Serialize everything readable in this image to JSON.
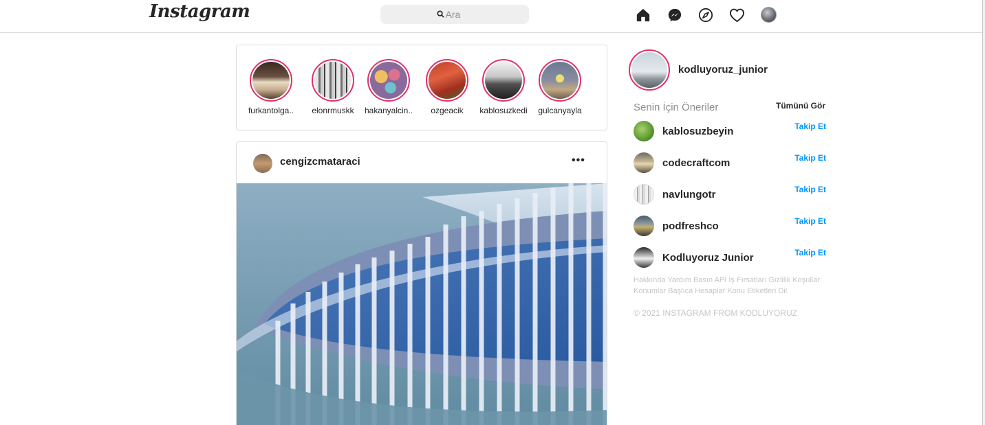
{
  "nav": {
    "logo": "Instagram",
    "search_placeholder": "Ara"
  },
  "stories": [
    {
      "name": "furkantolga.."
    },
    {
      "name": "elonrmuskk"
    },
    {
      "name": "hakanyalcin.."
    },
    {
      "name": "ozgeacik"
    },
    {
      "name": "kablosuzkedi"
    },
    {
      "name": "gulcanyayla"
    }
  ],
  "post": {
    "username": "cengizcmataraci",
    "more": "•••"
  },
  "sidebar": {
    "username": "kodluyoruz_junior",
    "suggestions_title": "Senin İçin Öneriler",
    "see_all": "Tümünü Gör",
    "suggestions": [
      {
        "name": "kablosuzbeyin",
        "action": "Takip Et"
      },
      {
        "name": "codecraftcom",
        "action": "Takip Et"
      },
      {
        "name": "navlungotr",
        "action": "Takip Et"
      },
      {
        "name": "podfreshco",
        "action": "Takip Et"
      },
      {
        "name": "Kodluyoruz Junior",
        "action": "Takip Et"
      }
    ],
    "footer_links": "Hakkında Yardım Basın API İş Fırsatları Gizlilik Koşullar Konumlar Başlıca Hesaplar Konu Etiketleri Dil",
    "copyright": "© 2021 INSTAGRAM FROM KODLUYORUZ"
  },
  "icons": {
    "home": "home-icon",
    "messenger": "messenger-icon",
    "explore": "compass-icon",
    "activity": "heart-icon",
    "search": "search-icon",
    "more": "more-options-icon"
  },
  "colors": {
    "story_ring": "#e1306c",
    "follow": "#0095f6",
    "border": "#dbdbdb"
  }
}
